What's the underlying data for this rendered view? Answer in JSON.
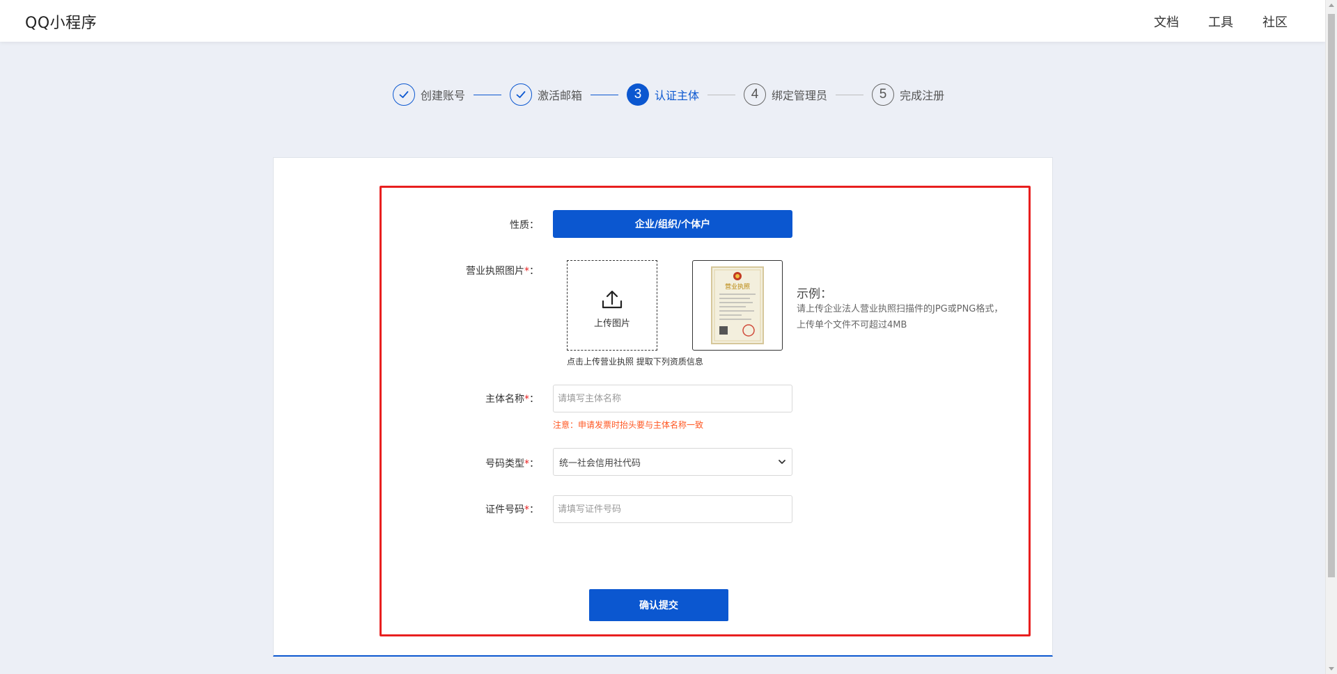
{
  "header": {
    "logo": "QQ小程序",
    "nav": [
      {
        "label": "文档"
      },
      {
        "label": "工具"
      },
      {
        "label": "社区"
      }
    ]
  },
  "steps": [
    {
      "index": "1",
      "label": "创建账号",
      "state": "done"
    },
    {
      "index": "2",
      "label": "激活邮箱",
      "state": "done"
    },
    {
      "index": "3",
      "label": "认证主体",
      "state": "active"
    },
    {
      "index": "4",
      "label": "绑定管理员",
      "state": "todo"
    },
    {
      "index": "5",
      "label": "完成注册",
      "state": "todo"
    }
  ],
  "form": {
    "nature": {
      "label": "性质：",
      "button": "企业/组织/个体户"
    },
    "license": {
      "label": "营业执照图片",
      "required_mark": "*",
      "colon": "：",
      "upload_text": "上传图片",
      "upload_hint": "点击上传营业执照 提取下列资质信息",
      "sample_title": "示例：",
      "sample_desc": "请上传企业法人营业执照扫描件的JPG或PNG格式，上传单个文件不可超过4MB",
      "sample_image_title": "营业执照"
    },
    "entity_name": {
      "label": "主体名称",
      "required_mark": "*",
      "colon": "：",
      "placeholder": "请填写主体名称",
      "value": "",
      "note": "注意：申请发票时抬头要与主体名称一致"
    },
    "code_type": {
      "label": "号码类型",
      "required_mark": "*",
      "colon": "：",
      "selected": "统一社会信用社代码"
    },
    "cert_number": {
      "label": "证件号码",
      "required_mark": "*",
      "colon": "：",
      "placeholder": "请填写证件号码",
      "value": ""
    },
    "submit": "确认提交"
  },
  "colors": {
    "primary": "#0b57d0",
    "highlight_border": "#e81f1f",
    "note": "#ff5722",
    "background": "#eceff6"
  }
}
